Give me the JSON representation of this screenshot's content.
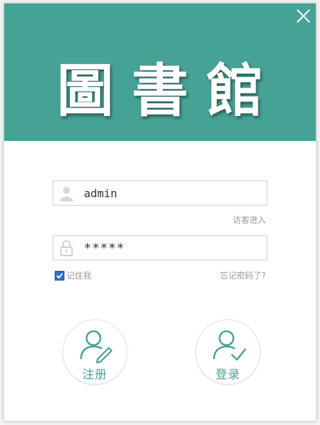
{
  "header": {
    "title": "圖書館"
  },
  "login": {
    "username_value": "admin",
    "password_value": "*****",
    "guest_link": "访客进入",
    "remember_label": "记住我",
    "forgot_link": "忘记密码了?"
  },
  "actions": {
    "register_label": "注册",
    "login_label": "登录"
  },
  "colors": {
    "accent": "#46a295",
    "checkbox": "#2b6fc9"
  },
  "icons": {
    "close": "close-icon",
    "user": "user-icon",
    "lock": "lock-icon",
    "register": "user-edit-icon",
    "login": "user-check-icon"
  }
}
